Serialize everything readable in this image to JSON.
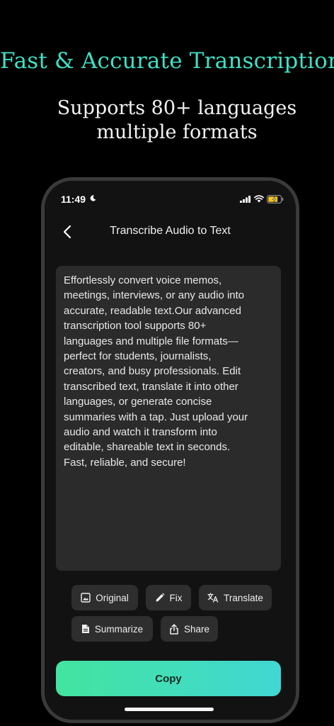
{
  "promo": {
    "title": "Fast & Accurate Transcription",
    "subtitle_line1": "Supports 80+ languages",
    "subtitle_line2": "multiple formats"
  },
  "status_bar": {
    "time": "11:49",
    "icons": [
      "moon-icon",
      "signal-icon",
      "wifi-icon",
      "battery-charging-icon"
    ]
  },
  "nav": {
    "back_icon": "chevron-left-icon",
    "title": "Transcribe Audio to Text"
  },
  "transcript": {
    "text": "Effortlessly convert voice memos,\nmeetings, interviews, or any audio into\naccurate, readable text.Our advanced\ntranscription tool supports 80+\nlanguages and multiple file formats—\nperfect for students, journalists,\ncreators, and busy professionals. Edit\ntranscribed text, translate it into other\nlanguages, or generate concise\nsummaries with a tap. Just upload your\naudio and watch it transform into\neditable, shareable text in seconds.\nFast, reliable, and secure!"
  },
  "actions": {
    "original": {
      "label": "Original",
      "icon": "image-icon"
    },
    "fix": {
      "label": "Fix",
      "icon": "pencil-icon"
    },
    "translate": {
      "label": "Translate",
      "icon": "translate-icon"
    },
    "summarize": {
      "label": "Summarize",
      "icon": "document-icon"
    },
    "share": {
      "label": "Share",
      "icon": "share-icon"
    }
  },
  "copy_button": {
    "label": "Copy"
  },
  "colors": {
    "accent_teal": "#3fe0c5",
    "copy_gradient_start": "#42e49f",
    "copy_gradient_end": "#41d7d4",
    "card_bg": "#2b2b2b",
    "button_bg": "#2e2e2e"
  }
}
